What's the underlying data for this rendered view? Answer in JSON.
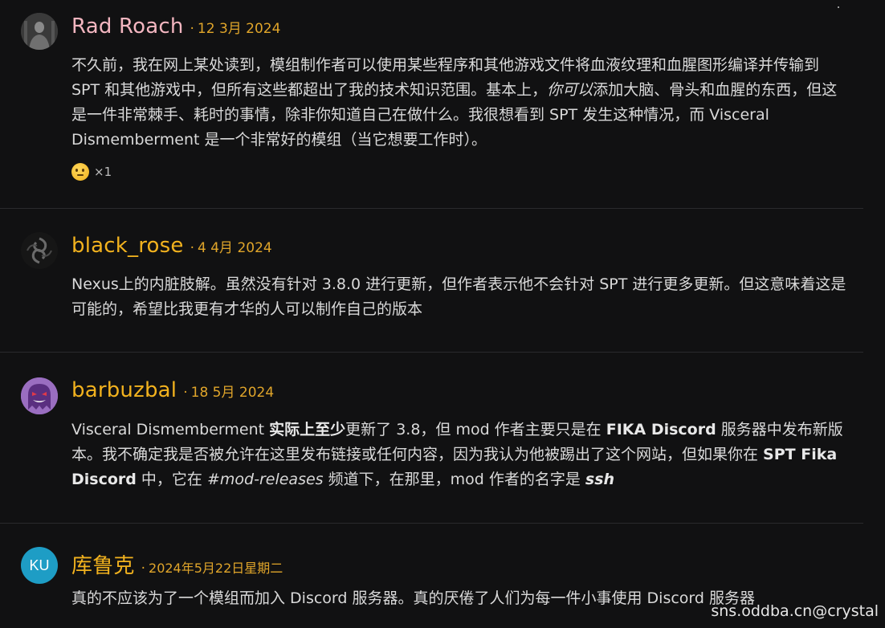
{
  "colors": {
    "background": "#111112",
    "date": "#e0a52a",
    "author_default": "#f2b21e",
    "author_rad_roach": "#f3b6c0",
    "ku_avatar_bg": "#1e9dc5"
  },
  "comments": [
    {
      "author": "Rad Roach",
      "separator": "·",
      "date": "12 3月 2024",
      "avatar_icon": "gray-figure-avatar",
      "body_segments": [
        "不久前，我在网上某处读到，模组制作者可以使用某些程序和其他游戏文件将血液纹理和血腥图形编译并传输到 SPT 和其他游戏中，但所有这些都超出了我的技术知识范围。基本上，",
        "你可以",
        "添加大脑、骨头和血腥的东西，但这是一件非常棘手、耗时的事情，除非你知道自己在做什么。我很想看到 SPT 发生这种情况，而 Visceral Dismemberment 是一个非常好的模组（当它想要工作时）。"
      ],
      "reaction": {
        "icon": "thinking-face-icon",
        "count": "×1"
      }
    },
    {
      "author": "black_rose",
      "separator": "·",
      "date": "4 4月 2024",
      "avatar_icon": "black-rose-avatar",
      "body": "Nexus上的内脏肢解。虽然没有针对 3.8.0 进行更新，但作者表示他不会针对 SPT 进行更多更新。但这意味着这是可能的，希望比我更有才华的人可以制作自己的版本"
    },
    {
      "author": "barbuzbal",
      "separator": "·",
      "date": "18 5月 2024",
      "avatar_icon": "purple-ghost-avatar",
      "body_segments": [
        "Visceral Dismemberment ",
        "实际上至少",
        "更新了 3.8，但 mod 作者主要只是在 ",
        "FIKA Discord",
        " 服务器中发布新版本。我不确定我是否被允许在这里发布链接或任何内容，因为我认为他被踢出了这个网站，但如果你在 ",
        "SPT Fika Discord",
        " 中，它在 ",
        "#mod-releases",
        " 频道下，在那里，mod 作者的名字是 ",
        "ssh"
      ]
    },
    {
      "author": "库鲁克",
      "separator": "·",
      "date": "2024年5月22日星期二",
      "avatar_initials": "KU",
      "body": "真的不应该为了一个模组而加入 Discord 服务器。真的厌倦了人们为每一件小事使用 Discord 服务器"
    }
  ],
  "watermark": "sns.oddba.cn@crystal"
}
